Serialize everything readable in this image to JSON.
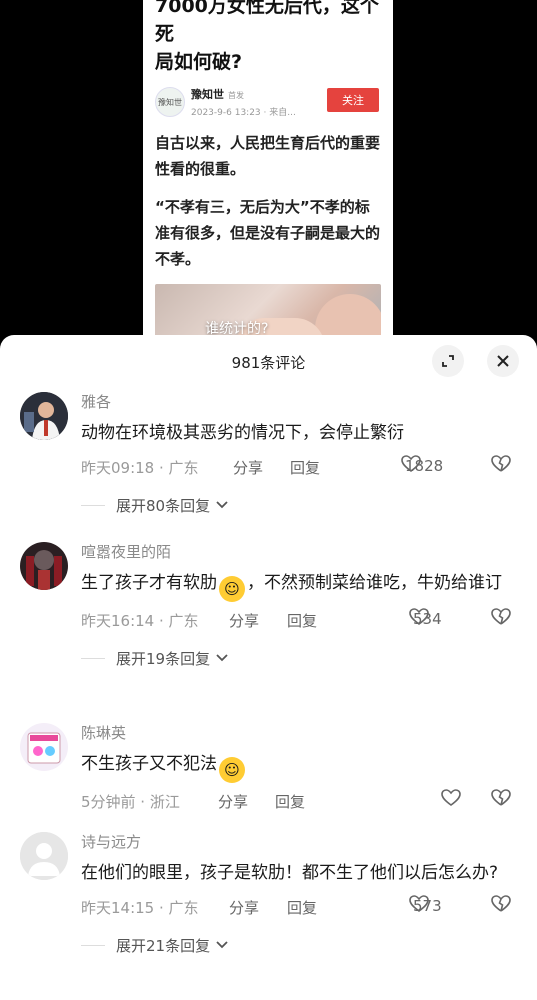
{
  "article": {
    "title_line1": "7000万女性无后代，这个死",
    "title_line2": "局如何破?",
    "author": "豫知世",
    "author_badge": "首发",
    "avatar_text": "豫知世",
    "time": "2023-9-6 13:23 · 来自...",
    "follow_label": "关注",
    "para1": "自古以来，人民把生育后代的重要性看的很重。",
    "para2": "“不孝有三，无后为大”不孝的标准有很多，但是没有子嗣是最大的不孝。",
    "image_caption": "谁统计的?"
  },
  "sheet": {
    "title": "981条评论"
  },
  "comments": [
    {
      "name": "雅各",
      "text": "动物在环境极其恶劣的情况下，会停止繁衍",
      "time_loc": "昨天09:18 · 广东",
      "share": "分享",
      "reply": "回复",
      "likes": "1828",
      "expand": "展开80条回复"
    },
    {
      "name": "喧嚣夜里的陌",
      "text_a": "生了孩子才有软肋",
      "text_b": "，不然预制菜给谁吃，牛奶给谁订",
      "time_loc": "昨天16:14 · 广东",
      "share": "分享",
      "reply": "回复",
      "likes": "534",
      "expand": "展开19条回复"
    },
    {
      "name": "陈琳英",
      "text": "不生孩子又不犯法",
      "time_loc": "5分钟前 · 浙江",
      "share": "分享",
      "reply": "回复",
      "likes": "",
      "expand": ""
    },
    {
      "name": "诗与远方",
      "text": "在他们的眼里，孩子是软肋！都不生了他们以后怎么办?",
      "time_loc": "昨天14:15 · 广东",
      "share": "分享",
      "reply": "回复",
      "likes": "573",
      "expand": "展开21条回复"
    }
  ],
  "icons": {
    "expand": "expand-icon",
    "close": "close-icon",
    "like": "heart-icon",
    "dislike": "broken-heart-icon",
    "chevron": "chevron-down-icon"
  },
  "colors": {
    "follow_button": "#e5433e",
    "name_text": "#8a8a8a",
    "meta_text": "#9a9a9a"
  }
}
